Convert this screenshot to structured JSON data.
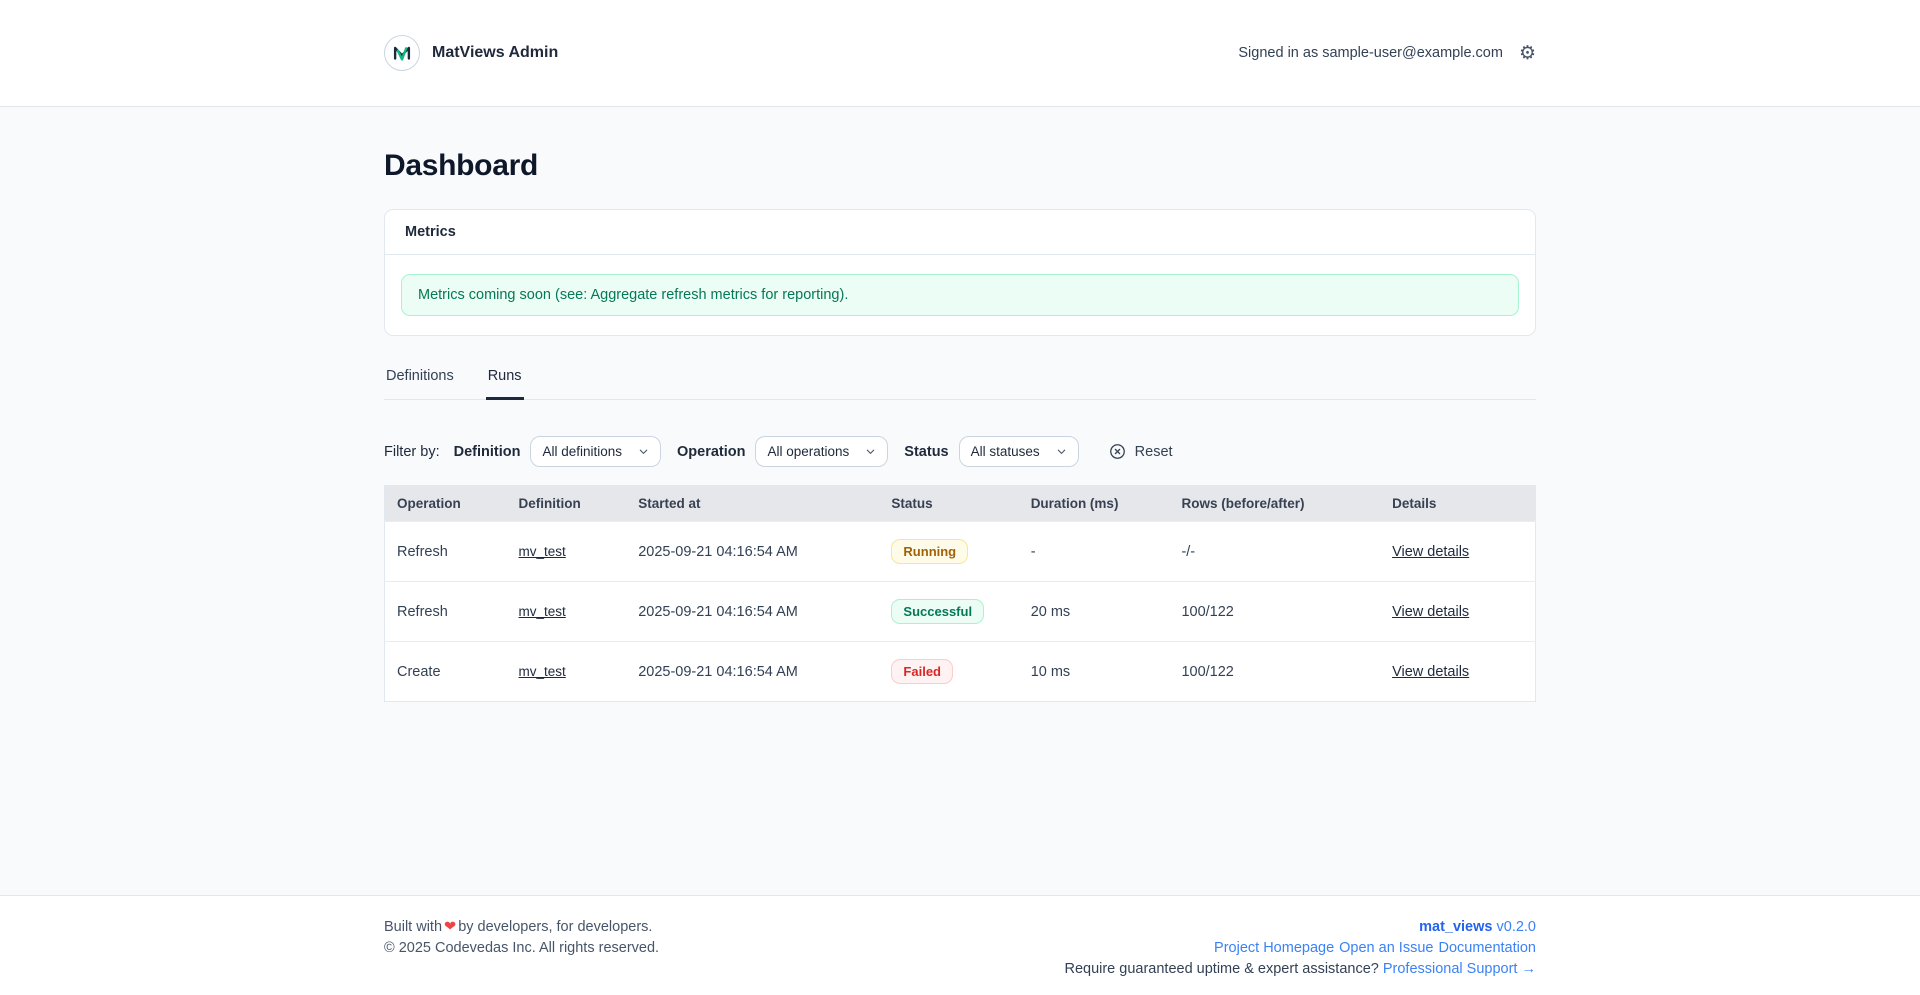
{
  "header": {
    "app_title": "MatViews Admin",
    "signed_in": "Signed in as sample-user@example.com",
    "gear_glyph": "⚙"
  },
  "page": {
    "title": "Dashboard"
  },
  "metrics_card": {
    "title": "Metrics",
    "notice": "Metrics coming soon (see: Aggregate refresh metrics for reporting)."
  },
  "tabs": [
    {
      "label": "Definitions",
      "active": false
    },
    {
      "label": "Runs",
      "active": true
    }
  ],
  "filters": {
    "filter_by_label": "Filter by:",
    "definition_label": "Definition",
    "definition_value": "All definitions",
    "operation_label": "Operation",
    "operation_value": "All operations",
    "status_label": "Status",
    "status_value": "All statuses",
    "reset_label": "Reset"
  },
  "table": {
    "columns": [
      "Operation",
      "Definition",
      "Started at",
      "Status",
      "Duration (ms)",
      "Rows (before/after)",
      "Details"
    ],
    "rows": [
      {
        "operation": "Refresh",
        "definition": "mv_test",
        "started_at": "2025-09-21 04:16:54 AM",
        "status": "Running",
        "duration": "-",
        "rows": "-/-",
        "details": "View details"
      },
      {
        "operation": "Refresh",
        "definition": "mv_test",
        "started_at": "2025-09-21 04:16:54 AM",
        "status": "Successful",
        "duration": "20 ms",
        "rows": "100/122",
        "details": "View details"
      },
      {
        "operation": "Create",
        "definition": "mv_test",
        "started_at": "2025-09-21 04:16:54 AM",
        "status": "Failed",
        "duration": "10 ms",
        "rows": "100/122",
        "details": "View details"
      }
    ]
  },
  "footer": {
    "built_with_prefix": "Built with",
    "heart_glyph": "❤",
    "built_with_suffix": "by developers, for developers.",
    "copyright": "© 2025 Codevedas Inc. All rights reserved.",
    "package_name": "mat_views",
    "version": "v0.2.0",
    "links": [
      "Project Homepage",
      "Open an Issue",
      "Documentation"
    ],
    "support_question": "Require guaranteed uptime & expert assistance?",
    "support_link": "Professional Support →"
  },
  "colors": {
    "accent_green": "#10b981",
    "brand_navy": "#1e293b",
    "link_blue": "#3b82f6",
    "status_running": "#a16207",
    "status_successful": "#047857",
    "status_failed": "#dc2626"
  }
}
